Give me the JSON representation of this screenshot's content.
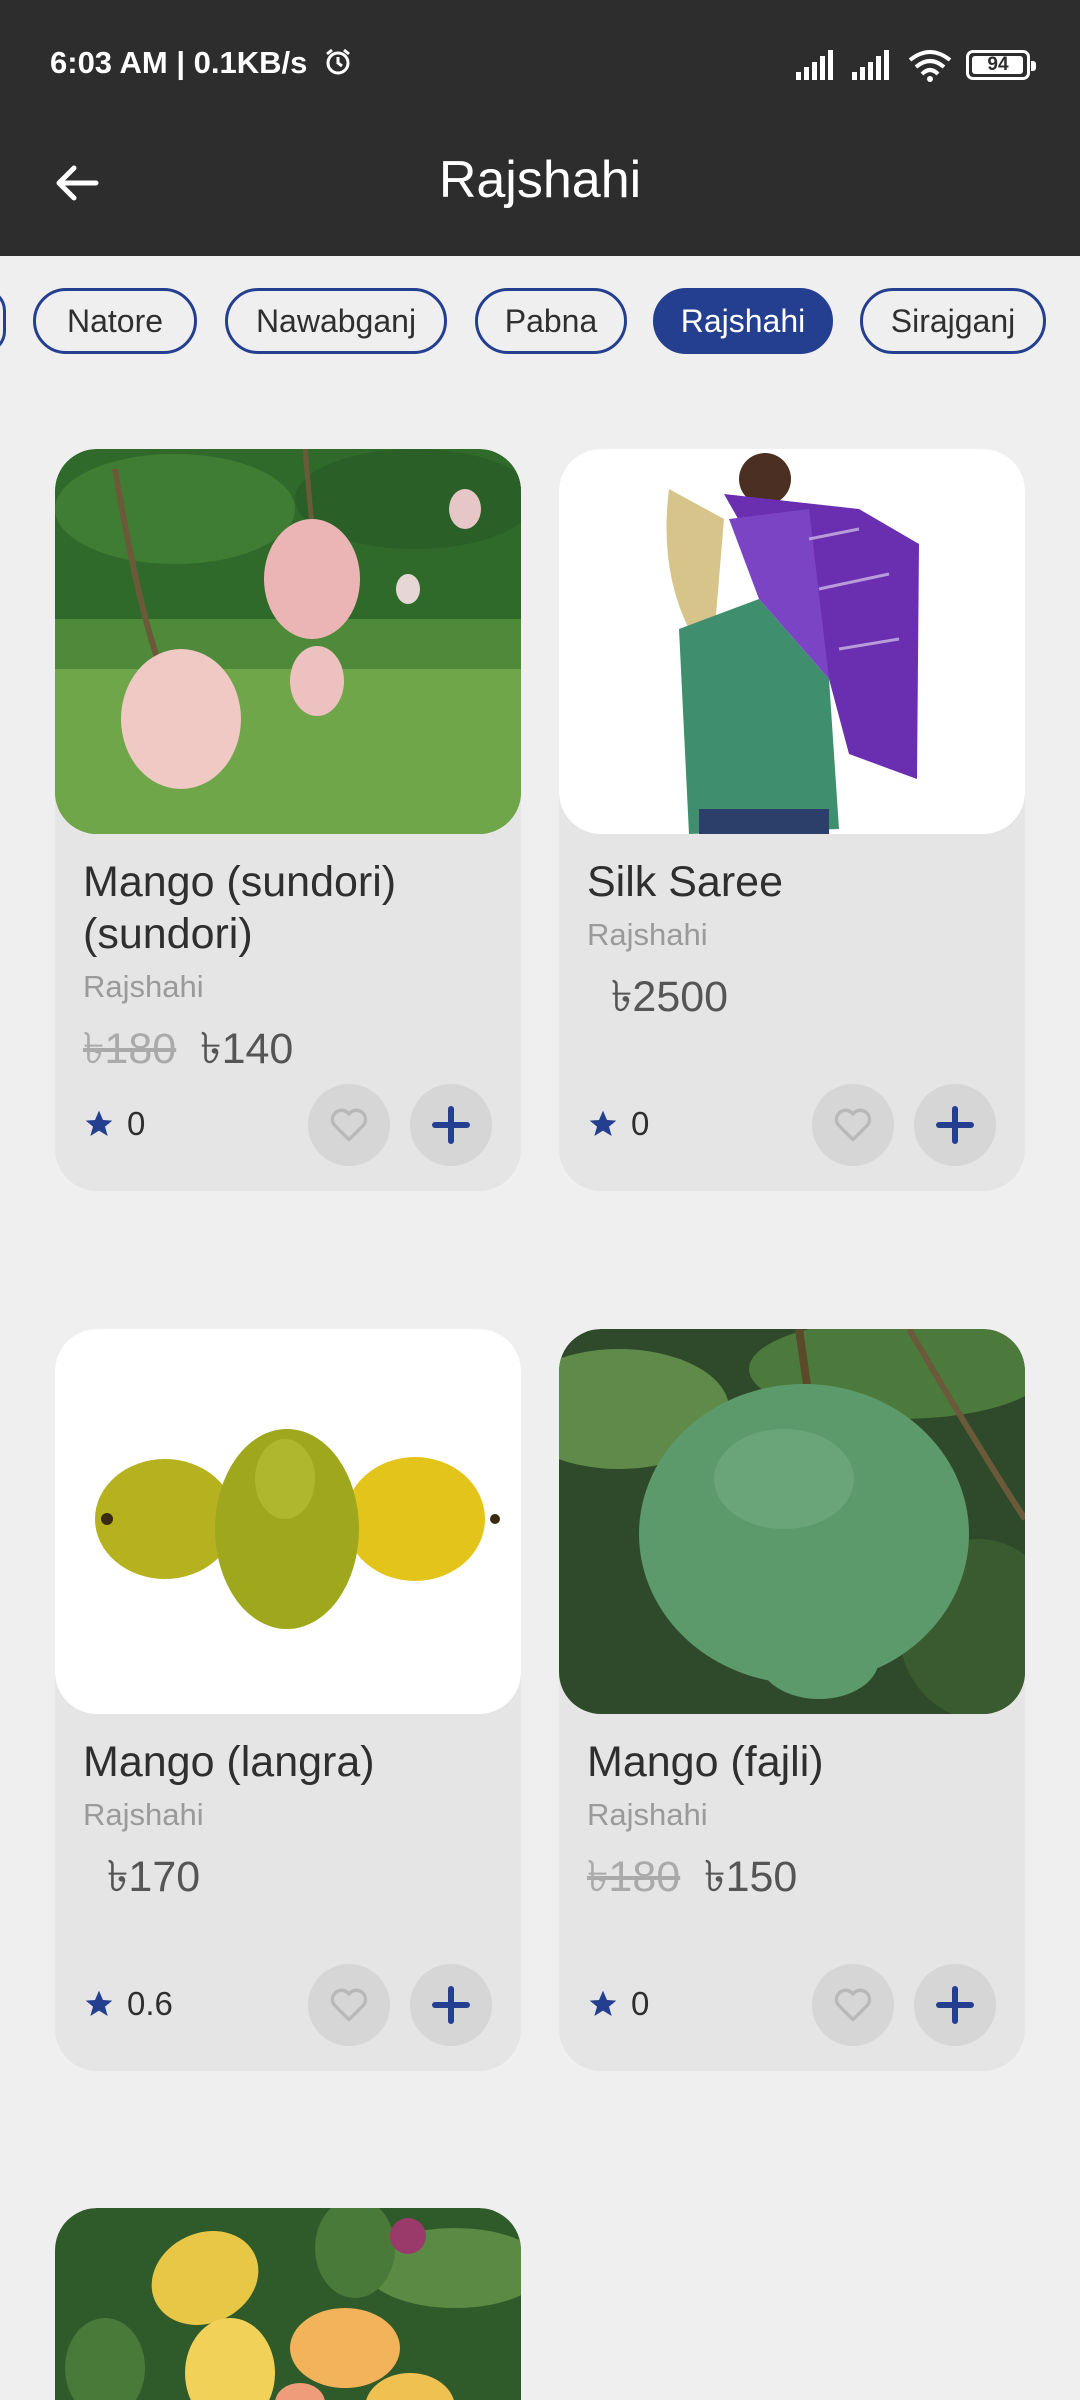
{
  "status": {
    "time": "6:03 AM | 0.1KB/s",
    "battery": "94"
  },
  "header": {
    "title": "Rajshahi"
  },
  "chips": [
    {
      "label": "Natore"
    },
    {
      "label": "Nawabganj"
    },
    {
      "label": "Pabna"
    },
    {
      "label": "Rajshahi",
      "active": true
    },
    {
      "label": "Sirajganj"
    }
  ],
  "products": [
    {
      "name": "Mango (sundori) (sundori)",
      "location": "Rajshahi",
      "old_price": "৳180",
      "price": "৳140",
      "rating": "0"
    },
    {
      "name": "Silk Saree",
      "location": "Rajshahi",
      "old_price": "",
      "price": "৳2500",
      "rating": "0"
    },
    {
      "name": "Mango (langra)",
      "location": "Rajshahi",
      "old_price": "",
      "price": "৳170",
      "rating": "0.6"
    },
    {
      "name": "Mango (fajli)",
      "location": "Rajshahi",
      "old_price": "৳180",
      "price": "৳150",
      "rating": "0"
    }
  ],
  "colors": {
    "accent": "#243f8f",
    "bar": "#2d2d2d",
    "background": "#efefef",
    "card": "#e5e5e5"
  }
}
